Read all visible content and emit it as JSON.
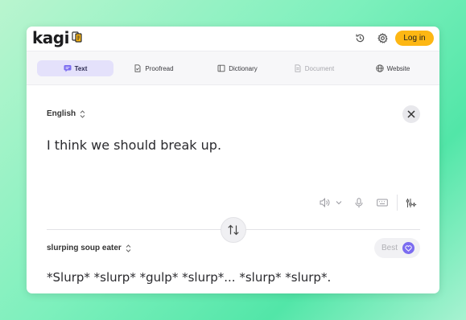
{
  "header": {
    "logo_text": "kagi",
    "logo_icon": "translate-book-icon",
    "history_icon": "history-icon",
    "settings_icon": "gear-icon",
    "login_label": "Log in"
  },
  "tabs": [
    {
      "label": "Text",
      "icon": "chat-bubble-icon",
      "active": true
    },
    {
      "label": "Proofread",
      "icon": "document-check-icon"
    },
    {
      "label": "Dictionary",
      "icon": "book-icon"
    },
    {
      "label": "Document",
      "icon": "file-icon",
      "disabled": true
    },
    {
      "label": "Website",
      "icon": "globe-icon"
    }
  ],
  "source": {
    "language": "English",
    "text": "I think we should break up."
  },
  "target": {
    "language": "slurping soup eater",
    "quality_label": "Best",
    "text": "*Slurp* *slurp* *gulp* *slurp*... *slurp* *slurp*."
  },
  "colors": {
    "accent_yellow": "#fdb714",
    "active_tab_bg": "#e4e1fb",
    "best_purple": "#7b6cf0"
  }
}
